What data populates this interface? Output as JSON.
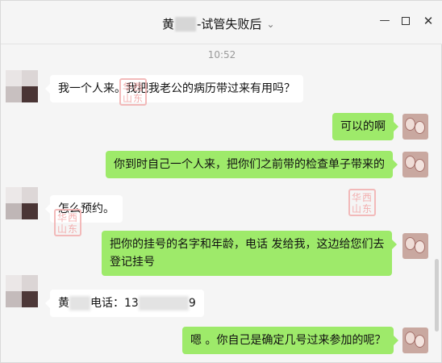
{
  "window": {
    "title_prefix": "黄",
    "title_suffix": "-试管失败后",
    "chevron": "chevron-down-icon",
    "controls": [
      "minimize-icon",
      "maximize-icon",
      "close-icon"
    ]
  },
  "timestamp": "10:52",
  "messages": [
    {
      "side": "in",
      "text": "我一个人来。我把我老公的病历带过来有用吗？"
    },
    {
      "side": "out",
      "text": "可以的啊"
    },
    {
      "side": "out",
      "text": "你到时自己一个人来，把你们之前带的检查单子带来的"
    },
    {
      "side": "in",
      "text": "怎么预约。"
    },
    {
      "side": "out",
      "line1": "把你的挂号的名字和年龄，电话 发给我，这边给您们去",
      "line2": "登记挂号"
    },
    {
      "side": "in",
      "prefix": "黄",
      "mid": "电话：13",
      "suffix": "9"
    },
    {
      "side": "out",
      "text": "嗯 。你自己是确定几号过来参加的呢？"
    }
  ],
  "watermark": {
    "line1": "华西",
    "line2": "山东"
  },
  "colors": {
    "in_bubble": "#ffffff",
    "out_bubble": "#9eea6a",
    "background": "#f5f5f5",
    "stamp": "#f2a8a8"
  }
}
